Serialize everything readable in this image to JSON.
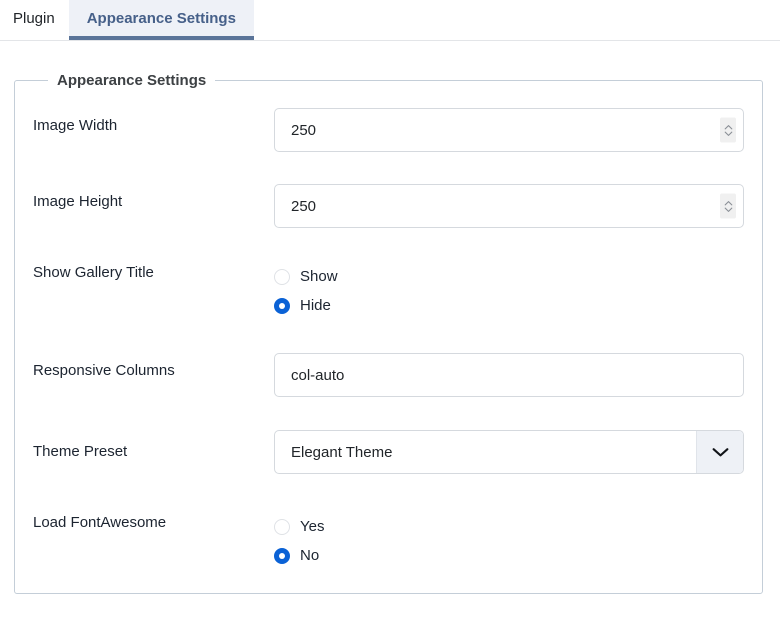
{
  "tabs": [
    {
      "label": "Plugin",
      "active": false
    },
    {
      "label": "Appearance Settings",
      "active": true
    }
  ],
  "fieldset": {
    "legend": "Appearance Settings"
  },
  "fields": {
    "image_width": {
      "label": "Image Width",
      "value": "250",
      "placeholder": ""
    },
    "image_height": {
      "label": "Image Height",
      "value": "250",
      "placeholder": ""
    },
    "show_gallery_title": {
      "label": "Show Gallery Title",
      "options": [
        {
          "label": "Show",
          "checked": false
        },
        {
          "label": "Hide",
          "checked": true
        }
      ]
    },
    "responsive_columns": {
      "label": "Responsive Columns",
      "value": "col-auto",
      "placeholder": ""
    },
    "theme_preset": {
      "label": "Theme Preset",
      "value": "Elegant Theme"
    },
    "load_fontawesome": {
      "label": "Load FontAwesome",
      "options": [
        {
          "label": "Yes",
          "checked": false
        },
        {
          "label": "No",
          "checked": true
        }
      ]
    }
  },
  "colors": {
    "active_tab_underline": "#5a7499",
    "active_tab_text": "#466089",
    "active_tab_bg": "#eef1f7",
    "radio_selected": "#0b62d6",
    "label_text": "#1c2430",
    "fieldset_border": "#c4ced8"
  }
}
